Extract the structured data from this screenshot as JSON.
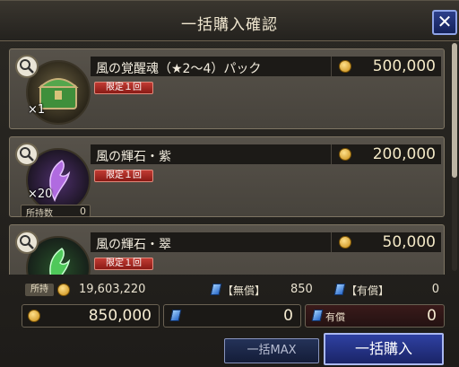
{
  "window": {
    "title": "一括購入確認"
  },
  "items": [
    {
      "name": "風の覚醒魂（★2～4）パック",
      "price": "500,000",
      "limit_label": "限定１回",
      "quantity": "×1",
      "owned_label": "",
      "owned_count": ""
    },
    {
      "name": "風の輝石・紫",
      "price": "200,000",
      "limit_label": "限定１回",
      "quantity": "×20",
      "owned_label": "所持数",
      "owned_count": "0"
    },
    {
      "name": "風の輝石・翠",
      "price": "50,000",
      "limit_label": "限定１回",
      "quantity": "",
      "owned_label": "",
      "owned_count": ""
    }
  ],
  "balances": {
    "owned_label": "所持",
    "gold": "19,603,220",
    "free_gem_label": "【無償】",
    "free_gem": "850",
    "paid_gem_label": "【有償】",
    "paid_gem": "0"
  },
  "cost": {
    "gold": "850,000",
    "free_gem": "0",
    "paid_label": "有償",
    "paid_gem": "0"
  },
  "buttons": {
    "max_label": "一括MAX",
    "buy_label": "一括購入",
    "close_label": "✕"
  },
  "colors": {
    "gold_text": "#f3e8c6",
    "limit_red": "#c13b33",
    "buy_blue": "#2f41a2"
  }
}
